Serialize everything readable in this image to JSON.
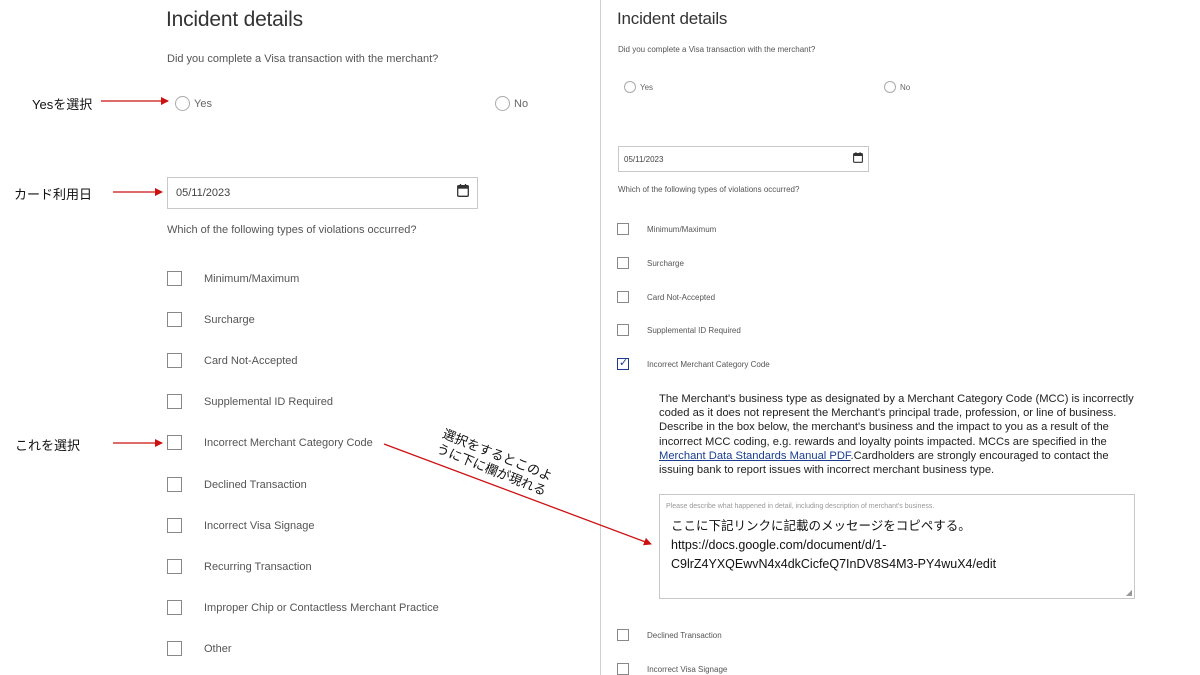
{
  "left": {
    "title": "Incident details",
    "question_transaction": "Did you complete a Visa transaction with the merchant?",
    "radio_yes": "Yes",
    "radio_no": "No",
    "date_value": "05/11/2023",
    "question_violations": "Which of the following types of violations occurred?",
    "violations": [
      "Minimum/Maximum",
      "Surcharge",
      "Card Not-Accepted",
      "Supplemental ID Required",
      "Incorrect Merchant Category Code",
      "Declined Transaction",
      "Incorrect Visa Signage",
      "Recurring Transaction",
      "Improper Chip or Contactless Merchant Practice",
      "Other"
    ]
  },
  "right": {
    "title": "Incident details",
    "question_transaction": "Did you complete a Visa transaction with the merchant?",
    "radio_yes": "Yes",
    "radio_no": "No",
    "date_value": "05/11/2023",
    "question_violations": "Which of the following types of violations occurred?",
    "violations": [
      "Minimum/Maximum",
      "Surcharge",
      "Card Not-Accepted",
      "Supplemental ID Required",
      "Incorrect Merchant Category Code",
      "Declined Transaction",
      "Incorrect Visa Signage"
    ],
    "checked_violation": "Incorrect Merchant Category Code",
    "mcc_description_before_link": "The Merchant's business type as designated by a Merchant Category Code (MCC) is incorrectly coded as it does not represent the Merchant's principal trade, profession, or line of business. Describe in the box below, the merchant's business and the impact to you as a result of the incorrect MCC coding, e.g. rewards and loyalty points impacted. MCCs are specified in the ",
    "mcc_link_text": "Merchant Data Standards Manual PDF",
    "mcc_description_after_link": ".Cardholders are strongly encouraged to contact the issuing bank to report issues with incorrect merchant business type.",
    "textarea_placeholder": "Please describe what happened in detail, including description of merchant's business.",
    "textarea_lines": [
      "ここに下記リンクに記載のメッセージをコピペする。",
      "https://docs.google.com/document/d/1-",
      "C9lrZ4YXQEwvN4x4dkCicfeQ7InDV8S4M3-PY4wuX4/edit"
    ]
  },
  "annotations": {
    "select_yes": "Yesを選択",
    "card_date": "カード利用日",
    "select_this": "これを選択",
    "appears_line1": "選択をするとこのよ",
    "appears_line2": "うに下に欄が現れる"
  },
  "colors": {
    "annotation_arrow": "#cc1111",
    "checkbox_checked": "#1a3d8f",
    "link": "#1a3d8f"
  },
  "icons": {
    "calendar": "calendar-icon",
    "checkmark": "checkmark-icon",
    "resize_handle": "resize-handle-icon"
  }
}
